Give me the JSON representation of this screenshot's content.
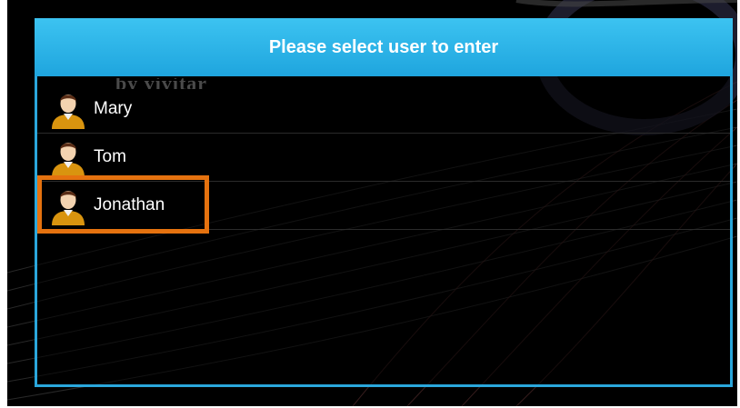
{
  "dialog": {
    "title": "Please select user to enter",
    "watermark": "by vivitar"
  },
  "users": [
    {
      "name": "Mary",
      "icon": "user-avatar-icon"
    },
    {
      "name": "Tom",
      "icon": "user-avatar-icon"
    },
    {
      "name": "Jonathan",
      "icon": "user-avatar-icon"
    }
  ],
  "highlighted_user": "Jonathan",
  "colors": {
    "header": "#2fb6ea",
    "border": "#2aa7dc",
    "highlight": "#e5720f",
    "background": "#000000",
    "avatar_shirt": "#d9940f"
  }
}
